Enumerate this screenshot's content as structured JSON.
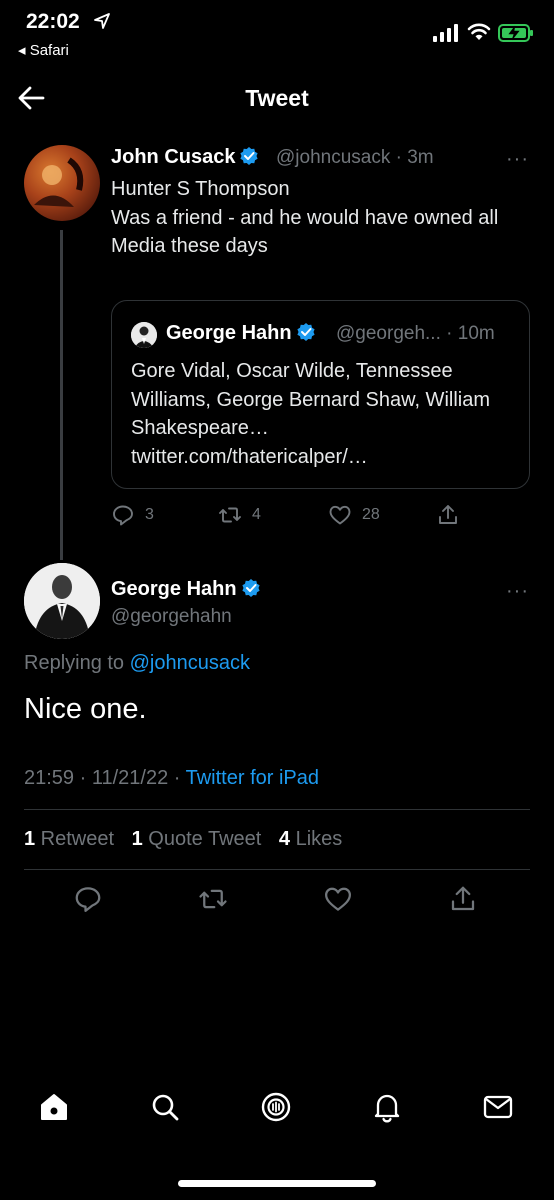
{
  "status_bar": {
    "time": "22:02",
    "back_app": "◂ Safari"
  },
  "nav": {
    "title": "Tweet"
  },
  "parent_tweet": {
    "author_name": "John Cusack",
    "author_handle": "@johncusack",
    "age": "· 3m",
    "more": "···",
    "text_lines": [
      "Hunter S Thompson",
      "Was a friend - and he would have owned all",
      "Media  these days"
    ],
    "quote": {
      "author_name": "George Hahn",
      "author_handle": "@georgeh...",
      "age": "· 10m",
      "text": "Gore Vidal, Oscar Wilde, Tennessee Williams, George Bernard Shaw, William Shakespeare… twitter.com/thatericalper/…"
    },
    "actions": {
      "replies": "3",
      "retweets": "4",
      "likes": "28"
    }
  },
  "main_tweet": {
    "author_name": "George Hahn",
    "author_handle": "@georgehahn",
    "more": "···",
    "replying_prefix": "Replying to ",
    "replying_to": "@johncusack",
    "text": "Nice one.",
    "timestamp": "21:59 · 11/21/22 · ",
    "source": "Twitter for iPad",
    "stats": {
      "retweets_count": "1",
      "retweets_label": " Retweet",
      "quotes_count": "1",
      "quotes_label": " Quote Tweet",
      "likes_count": "4",
      "likes_label": " Likes"
    }
  },
  "colors": {
    "accent": "#1d9bf0",
    "muted": "#71767b",
    "divider": "#2f3336",
    "background": "#000000"
  },
  "icons": [
    "location-arrow-icon",
    "cellular-signal-icon",
    "wifi-icon",
    "battery-charging-icon",
    "back-arrow-icon",
    "verified-badge-icon",
    "reply-icon",
    "retweet-icon",
    "like-icon",
    "share-icon",
    "home-icon",
    "search-icon",
    "spaces-icon",
    "notifications-icon",
    "messages-icon"
  ]
}
